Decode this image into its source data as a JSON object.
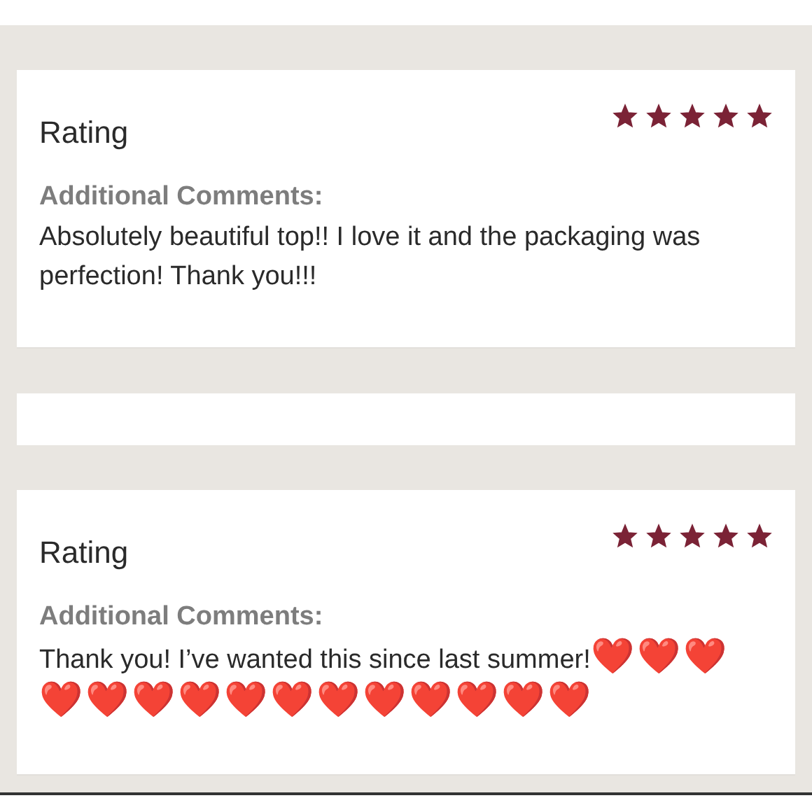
{
  "reviews": [
    {
      "heading": "Rating",
      "stars": 5,
      "comments_label": "Additional Comments:",
      "comment": "Absolutely beautiful top!! I love it and the packaging was perfection! Thank you!!!"
    },
    {
      "heading": "Rating",
      "stars": 5,
      "comments_label": "Additional Comments:",
      "comment": "Thank you! I’ve wanted this since last summer!",
      "emoji": [
        "❤️",
        "❤️",
        "❤️",
        "❤️",
        "❤️",
        "❤️",
        "❤️",
        "❤️",
        "❤️",
        "❤️",
        "❤️",
        "❤️",
        "❤️",
        "❤️",
        "❤️"
      ]
    }
  ]
}
